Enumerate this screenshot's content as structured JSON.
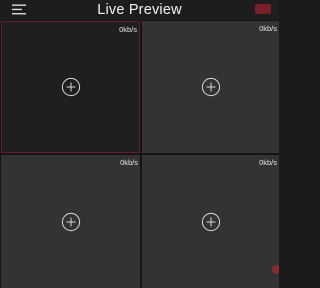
{
  "header": {
    "menu_icon": "hamburger-menu-icon",
    "title": "Live Preview",
    "record_icon": "record-indicator-icon",
    "accent": "#7a1f2a"
  },
  "grid": {
    "cells": [
      {
        "rate": "0kb/s",
        "selected": true,
        "add_icon": "add-circle-icon"
      },
      {
        "rate": "0kb/s",
        "selected": false,
        "add_icon": "add-circle-icon"
      },
      {
        "rate": "0kb/s",
        "selected": false,
        "add_icon": "add-circle-icon"
      },
      {
        "rate": "0kb/s",
        "selected": false,
        "add_icon": "add-circle-icon"
      }
    ]
  },
  "colors": {
    "background": "#1b1b1b",
    "cell": "#333333",
    "selected_cell": "#1f1f1f",
    "selected_border": "#6b1d28",
    "text": "#f2f2f2"
  }
}
